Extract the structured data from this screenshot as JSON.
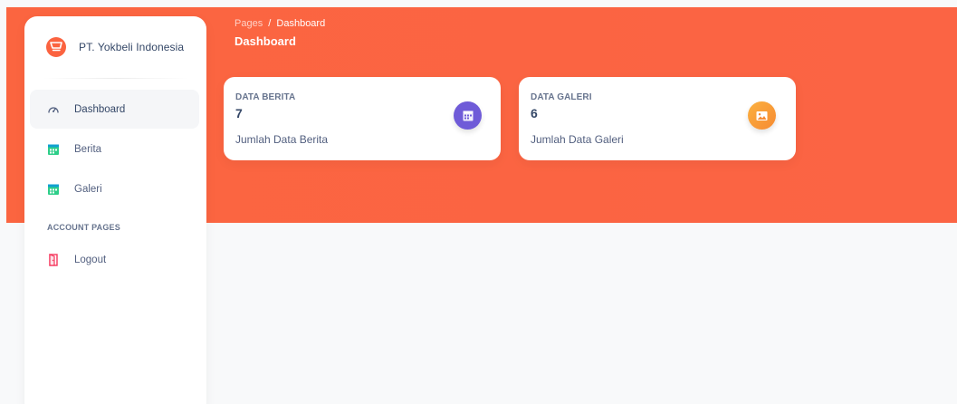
{
  "sidebar": {
    "brand": {
      "name": "PT. Yokbeli Indonesia",
      "logo_icon": "shopping-cart-icon"
    },
    "items": [
      {
        "label": "Dashboard",
        "icon": "dashboard-gauge-icon",
        "active": true
      },
      {
        "label": "Berita",
        "icon": "calendar-grid-icon",
        "active": false
      },
      {
        "label": "Galeri",
        "icon": "calendar-grid-icon",
        "active": false
      }
    ],
    "section_heading": "ACCOUNT PAGES",
    "account_items": [
      {
        "label": "Logout",
        "icon": "door-icon"
      }
    ]
  },
  "header": {
    "breadcrumb": {
      "parent": "Pages",
      "separator": "/",
      "current": "Dashboard"
    },
    "title": "Dashboard"
  },
  "cards": [
    {
      "label": "DATA BERITA",
      "value": "7",
      "description": "Jumlah Data Berita",
      "icon": "calendar-grid-icon",
      "icon_color": "#6f5bd8"
    },
    {
      "label": "DATA GALERI",
      "value": "6",
      "description": "Jumlah Data Galeri",
      "icon": "image-icon",
      "icon_color": "#f68a32"
    }
  ],
  "colors": {
    "header_bg": "#fb6340",
    "page_bg": "#f8f9fa",
    "brand_accent": "#fb6340"
  }
}
